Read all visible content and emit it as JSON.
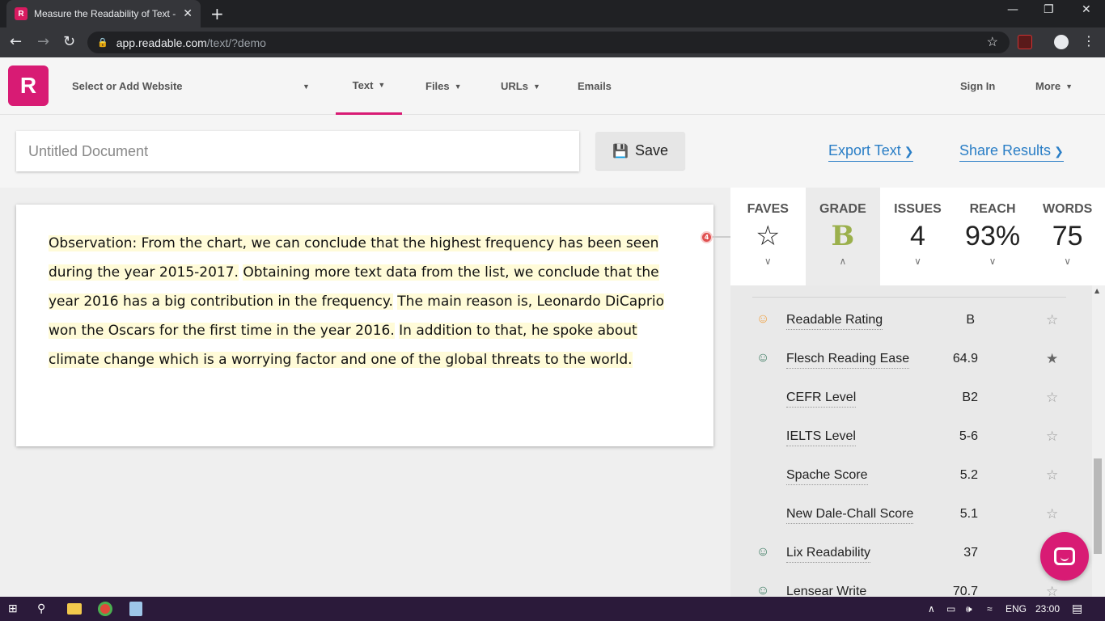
{
  "browser": {
    "tab_title": "Measure the Readability of Text -",
    "tab_favicon": "R",
    "new_tab": "+",
    "url_domain": "app.readable.com",
    "url_path": "/text/?demo"
  },
  "header": {
    "logo": "R",
    "website_select": "Select or Add Website",
    "nav": {
      "text": "Text",
      "files": "Files",
      "urls": "URLs",
      "emails": "Emails"
    },
    "sign_in": "Sign In",
    "more": "More",
    "accent": "#d81b74"
  },
  "doc": {
    "title_placeholder": "Untitled Document",
    "save": "Save",
    "export": "Export Text",
    "share": "Share Results"
  },
  "editor": {
    "sentences": [
      "Observation: From the chart, we can conclude that the highest frequency has been seen during the year 2015-2017.",
      "Obtaining more text data from the list, we conclude that the year 2016 has a big contribution in the frequency.",
      "The main reason is, Leonardo DiCaprio won the Oscars for the first time in the year 2016.",
      "In addition to that, he spoke about climate change which is a worrying factor and one of the global threats to the world."
    ],
    "issue_badge": "4"
  },
  "stats": {
    "faves_label": "FAVES",
    "grade_label": "GRADE",
    "grade_value": "B",
    "issues_label": "ISSUES",
    "issues_value": "4",
    "reach_label": "REACH",
    "reach_value": "93%",
    "words_label": "WORDS",
    "words_value": "75"
  },
  "scores": [
    {
      "name": "Readable Rating",
      "value": "B",
      "face": "neutral",
      "starred": false
    },
    {
      "name": "Flesch Reading Ease",
      "value": "64.9",
      "face": "happy",
      "starred": true
    },
    {
      "name": "CEFR Level",
      "value": "B2",
      "face": "",
      "starred": false
    },
    {
      "name": "IELTS Level",
      "value": "5-6",
      "face": "",
      "starred": false
    },
    {
      "name": "Spache Score",
      "value": "5.2",
      "face": "",
      "starred": false
    },
    {
      "name": "New Dale-Chall Score",
      "value": "5.1",
      "face": "",
      "starred": false
    },
    {
      "name": "Lix Readability",
      "value": "37",
      "face": "happy",
      "starred": false
    },
    {
      "name": "Lensear Write",
      "value": "70.7",
      "face": "happy",
      "starred": false
    }
  ],
  "taskbar": {
    "lang": "ENG",
    "time": "23:00"
  }
}
